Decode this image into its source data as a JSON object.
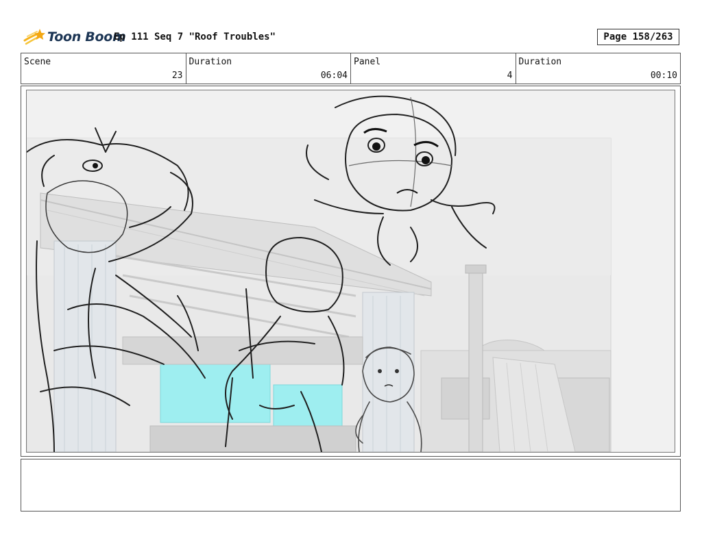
{
  "header": {
    "logo_text": "Toon Boom",
    "logo_icon": "comet-star-icon",
    "title": "Ep 111 Seq 7 \"Roof Troubles\"",
    "page": "Page 158/263"
  },
  "info": {
    "scene_label": "Scene",
    "scene_value": "23",
    "scene_duration_label": "Duration",
    "scene_duration_value": "06:04",
    "panel_label": "Panel",
    "panel_value": "4",
    "panel_duration_label": "Duration",
    "panel_duration_value": "00:10"
  },
  "panel": {
    "image": "storyboard-sketch",
    "accent_color": "#9eeef0"
  },
  "notes": {
    "text": ""
  }
}
